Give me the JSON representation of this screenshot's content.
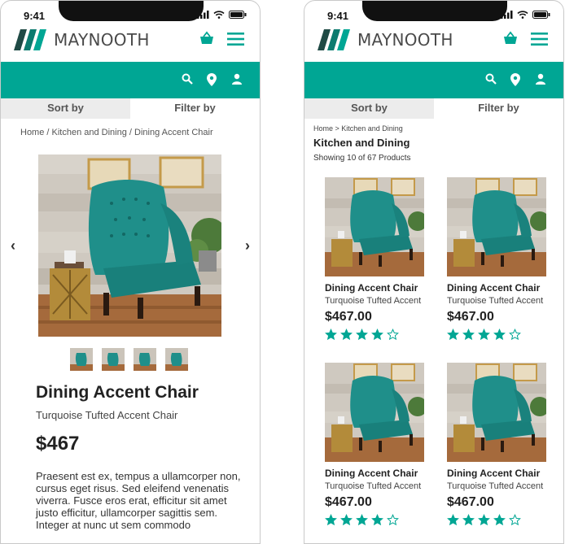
{
  "status": {
    "time": "9:41"
  },
  "brand": {
    "name": "MAYNOOTH"
  },
  "tabs": {
    "sort_label": "Sort by",
    "filter_label": "Filter by"
  },
  "colors": {
    "accent": "#00a694",
    "logo_dark": "#1f4a45",
    "logo_light": "#00a694"
  },
  "icons": [
    "basket-icon",
    "hamburger-icon",
    "search-icon",
    "location-icon",
    "user-icon",
    "chevron-left-icon",
    "chevron-right-icon",
    "star-icon"
  ],
  "product_page": {
    "breadcrumb": "Home / Kitchen and Dining / Dining Accent Chair",
    "title": "Dining Accent Chair",
    "subtitle": "Turquoise Tufted Accent Chair",
    "price": "$467",
    "description": "Praesent est ex, tempus a ullamcorper non, cursus eget risus. Sed eleifend venenatis viverra. Fusce eros erat, efficitur sit amet justo efficitur, ullamcorper sagittis sem. Integer at nunc ut sem commodo",
    "thumbnail_count": 4
  },
  "listing_page": {
    "breadcrumb": "Home > Kitchen and Dining",
    "title": "Kitchen and Dining",
    "showing": "Showing 10 of 67 Products",
    "products": [
      {
        "name": "Dining Accent Chair",
        "sub": "Turquoise Tufted Accent",
        "price": "$467.00",
        "rating": 4,
        "max": 5
      },
      {
        "name": "Dining Accent Chair",
        "sub": "Turquoise Tufted Accent",
        "price": "$467.00",
        "rating": 4,
        "max": 5
      },
      {
        "name": "Dining Accent Chair",
        "sub": "Turquoise Tufted Accent",
        "price": "$467.00",
        "rating": 4,
        "max": 5
      },
      {
        "name": "Dining Accent Chair",
        "sub": "Turquoise Tufted Accent",
        "price": "$467.00",
        "rating": 4,
        "max": 5
      }
    ]
  }
}
